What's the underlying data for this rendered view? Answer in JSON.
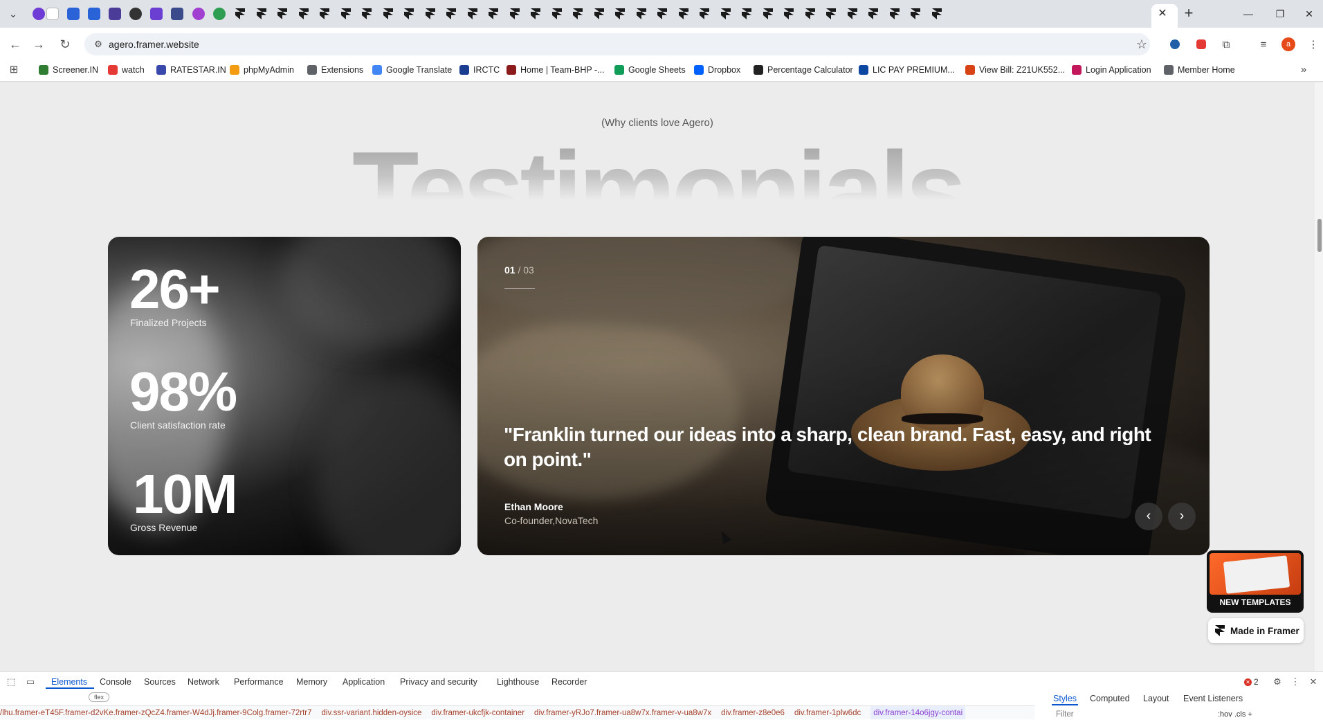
{
  "browser": {
    "url": "agero.framer.website",
    "bookmarks": [
      {
        "label": "Screener.IN",
        "color": "#2e7d32"
      },
      {
        "label": "watch",
        "color": "#e53935"
      },
      {
        "label": "RATESTAR.IN",
        "color": "#3949ab"
      },
      {
        "label": "phpMyAdmin",
        "color": "#f39c12"
      },
      {
        "label": "Extensions",
        "color": "#5f6368"
      },
      {
        "label": "Google Translate",
        "color": "#4285f4"
      },
      {
        "label": "IRCTC",
        "color": "#1a3d8f"
      },
      {
        "label": "Home | Team-BHP -...",
        "color": "#8b1a1a"
      },
      {
        "label": "Google Sheets",
        "color": "#0f9d58"
      },
      {
        "label": "Dropbox",
        "color": "#0061ff"
      },
      {
        "label": "Percentage Calculator",
        "color": "#222222"
      },
      {
        "label": "LIC PAY PREMIUM...",
        "color": "#0d47a1"
      },
      {
        "label": "View Bill: Z21UK552...",
        "color": "#d84315"
      },
      {
        "label": "Login Application",
        "color": "#c2185b"
      },
      {
        "label": "Member Home",
        "color": "#5f6368"
      }
    ]
  },
  "page": {
    "eyebrow": "(Why clients love Agero)",
    "section_title": "Testimonials",
    "stats": [
      {
        "value": "26+",
        "label": "Finalized Projects"
      },
      {
        "value": "98%",
        "label": "Client satisfaction rate"
      },
      {
        "value": "10M",
        "label": "Gross Revenue"
      }
    ],
    "testimonial": {
      "current": "01",
      "separator": " / ",
      "total": "03",
      "quote": "\"Franklin turned our ideas into a sharp, clean brand. Fast, easy, and right on point.\"",
      "author": "Ethan Moore",
      "role": "Co-founder,NovaTech"
    },
    "template_promo": "NEW TEMPLATES",
    "made_in_framer": "Made in Framer"
  },
  "devtools": {
    "tabs": [
      "Elements",
      "Console",
      "Sources",
      "Network",
      "Performance",
      "Memory",
      "Application",
      "Privacy and security",
      "Lighthouse",
      "Recorder"
    ],
    "error_count": "2",
    "flex_badge": "flex",
    "breadcrumbs": [
      "/lhu.framer-eT45F.framer-d2vKe.framer-zQcZ4.framer-W4dJj.framer-9Colg.framer-72rtr7",
      "div.ssr-variant.hidden-oysice",
      "div.framer-ukcfjk-container",
      "div.framer-yRJo7.framer-ua8w7x.framer-v-ua8w7x",
      "div.framer-z8e0e6",
      "div.framer-1plw6dc",
      "div.framer-14o6jgy-contai"
    ],
    "side_tabs": [
      "Styles",
      "Computed",
      "Layout",
      "Event Listeners"
    ],
    "filter_placeholder": "Filter",
    "side_tools": ":hov  .cls  +"
  }
}
